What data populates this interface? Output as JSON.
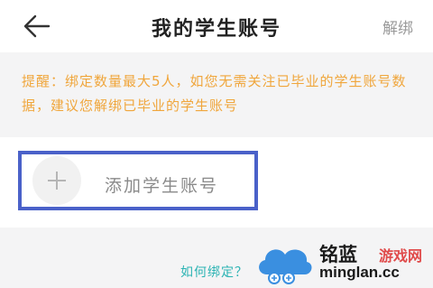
{
  "header": {
    "back_icon": "back-arrow-icon",
    "title": "我的学生账号",
    "unbind_label": "解绑"
  },
  "tip": {
    "text": "提醒：绑定数量最大5人，如您无需关注已毕业的学生账号数据，建议您解绑已毕业的学生账号"
  },
  "add_account": {
    "icon": "plus-icon",
    "label": "添加学生账号"
  },
  "how_to_bind": "如何绑定？",
  "watermark": {
    "brand": "铭蓝",
    "sub": "游戏网",
    "domain": "minglan.cc"
  },
  "colors": {
    "tip_text": "#f0a63c",
    "link": "#2bb3b3",
    "highlight_border": "#4a61c9"
  }
}
